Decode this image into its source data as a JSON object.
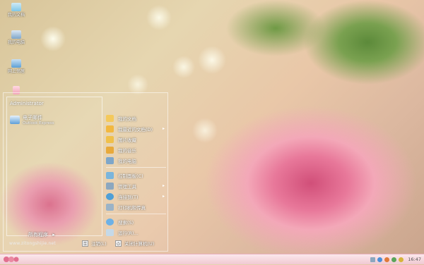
{
  "desktop": {
    "icons": [
      {
        "label": "我的文档",
        "color": "#7fc7e8"
      },
      {
        "label": "我的电脑",
        "color": "#7ea6c9"
      },
      {
        "label": "网上邻居",
        "color": "#5da0d6"
      }
    ]
  },
  "start_menu": {
    "user_name": "Administrator",
    "pinned": {
      "title": "电子邮件",
      "subtitle": "Outlook Express"
    },
    "all_programs": "所有程序",
    "right_items_top": [
      {
        "label": "我的文档",
        "color": "#f4c95c",
        "arrow": ""
      },
      {
        "label": "我最近的文档(D)",
        "color": "#f2b840",
        "arrow": "▸"
      },
      {
        "label": "图片收藏",
        "color": "#f0c04a",
        "arrow": ""
      },
      {
        "label": "我的音乐",
        "color": "#e8a93a",
        "arrow": ""
      },
      {
        "label": "我的电脑",
        "color": "#7ea6c9",
        "arrow": ""
      }
    ],
    "right_items_bottom": [
      {
        "label": "控制面板(C)",
        "color": "#7ab5dc",
        "arrow": ""
      },
      {
        "label": "管理工具",
        "color": "#8ca7bf",
        "arrow": "▸"
      },
      {
        "label": "连接到(T)",
        "color": "#4f9fd6",
        "arrow": "▸"
      },
      {
        "label": "打印机和传真",
        "color": "#9bb3c7",
        "arrow": ""
      }
    ],
    "right_items_tail": [
      {
        "label": "搜索(S)",
        "color": "#6db1e6",
        "arrow": ""
      },
      {
        "label": "运行(R)...",
        "color": "#c5d9e8",
        "arrow": ""
      }
    ],
    "footer": {
      "site": "www.zitongshijie.net",
      "logoff": "注销(L)",
      "shutdown": "关闭计算机(U)"
    }
  },
  "taskbar": {
    "clock": "16:47",
    "tray_colors": [
      "#4a90d9",
      "#e07a3a",
      "#5aa55a",
      "#d6b43a"
    ]
  }
}
